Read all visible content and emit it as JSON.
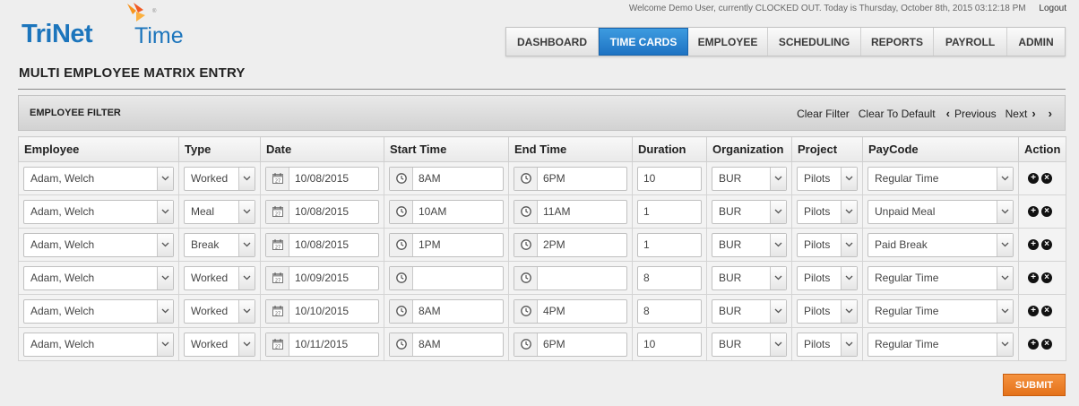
{
  "header": {
    "welcome": "Welcome Demo User, currently CLOCKED OUT. Today is Thursday, October 8th, 2015 03:12:18 PM",
    "logout": "Logout"
  },
  "logo": {
    "brand": "TriNet",
    "product": "Time",
    "reg": "®"
  },
  "nav": {
    "active_index": 1,
    "tabs": [
      {
        "label": "DASHBOARD"
      },
      {
        "label": "TIME CARDS"
      },
      {
        "label": "EMPLOYEE"
      },
      {
        "label": "SCHEDULING"
      },
      {
        "label": "REPORTS"
      },
      {
        "label": "PAYROLL"
      },
      {
        "label": "ADMIN"
      }
    ]
  },
  "page": {
    "title": "MULTI EMPLOYEE MATRIX ENTRY"
  },
  "filter": {
    "label": "EMPLOYEE FILTER",
    "clear_filter": "Clear Filter",
    "clear_default": "Clear To Default",
    "previous": "Previous",
    "next": "Next"
  },
  "table": {
    "headers": [
      "Employee",
      "Type",
      "Date",
      "Start Time",
      "End Time",
      "Duration",
      "Organization",
      "Project",
      "PayCode",
      "Action"
    ],
    "rows": [
      {
        "employee": "Adam, Welch",
        "type": "Worked",
        "date": "10/08/2015",
        "start": "8AM",
        "end": "6PM",
        "duration": "10",
        "org": "BUR",
        "project": "Pilots",
        "paycode": "Regular Time"
      },
      {
        "employee": "Adam, Welch",
        "type": "Meal",
        "date": "10/08/2015",
        "start": "10AM",
        "end": "11AM",
        "duration": "1",
        "org": "BUR",
        "project": "Pilots",
        "paycode": "Unpaid Meal"
      },
      {
        "employee": "Adam, Welch",
        "type": "Break",
        "date": "10/08/2015",
        "start": "1PM",
        "end": "2PM",
        "duration": "1",
        "org": "BUR",
        "project": "Pilots",
        "paycode": "Paid Break"
      },
      {
        "employee": "Adam, Welch",
        "type": "Worked",
        "date": "10/09/2015",
        "start": "",
        "end": "",
        "duration": "8",
        "org": "BUR",
        "project": "Pilots",
        "paycode": "Regular Time"
      },
      {
        "employee": "Adam, Welch",
        "type": "Worked",
        "date": "10/10/2015",
        "start": "8AM",
        "end": "4PM",
        "duration": "8",
        "org": "BUR",
        "project": "Pilots",
        "paycode": "Regular Time"
      },
      {
        "employee": "Adam, Welch",
        "type": "Worked",
        "date": "10/11/2015",
        "start": "8AM",
        "end": "6PM",
        "duration": "10",
        "org": "BUR",
        "project": "Pilots",
        "paycode": "Regular Time"
      }
    ]
  },
  "submit_label": "SUBMIT",
  "colors": {
    "brand_blue": "#1c75bc",
    "brand_orange": "#f7941d",
    "active_tab": "#1e73c3",
    "submit": "#e4721a"
  },
  "icons": {
    "calendar": "calendar-icon",
    "clock": "clock-icon",
    "add": "add-circle-icon",
    "remove": "remove-circle-icon",
    "dropdown": "chevron-down-icon"
  }
}
